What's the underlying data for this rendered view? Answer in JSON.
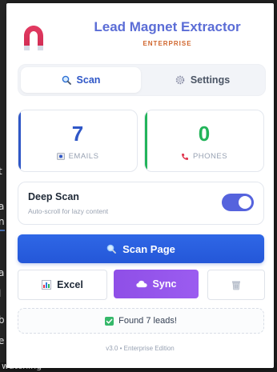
{
  "background": {
    "lines": [
      "t",
      "a",
      "n",
      "a",
      "l",
      "b",
      "e",
      "w"
    ],
    "bottom_text": "watching"
  },
  "header": {
    "title": "Lead Magnet Extractor",
    "subtitle": "ENTERPRISE",
    "logo_icon": "magnet-icon",
    "title_color": "#5b6dd6",
    "subtitle_color": "#d0652c"
  },
  "tabs": [
    {
      "label": "Scan",
      "icon": "search-icon",
      "active": true
    },
    {
      "label": "Settings",
      "icon": "gear-icon",
      "active": false
    }
  ],
  "stats": {
    "emails": {
      "value": "7",
      "label": "EMAILS",
      "icon": "email-icon",
      "color": "#2f57c7"
    },
    "phones": {
      "value": "0",
      "label": "PHONES",
      "icon": "phone-icon",
      "color": "#22b45a"
    }
  },
  "deep_scan": {
    "title": "Deep Scan",
    "subtitle": "Auto-scroll for lazy content",
    "enabled": true
  },
  "scan_button": {
    "label": "Scan Page",
    "icon": "search-icon"
  },
  "actions": {
    "excel": {
      "label": "Excel",
      "icon": "chart-icon"
    },
    "sync": {
      "label": "Sync",
      "icon": "cloud-icon"
    },
    "clear": {
      "icon": "trash-icon"
    }
  },
  "status": {
    "text": "Found 7 leads!",
    "icon": "checkmark-icon"
  },
  "footer": {
    "text": "v3.0 • Enterprise Edition"
  }
}
